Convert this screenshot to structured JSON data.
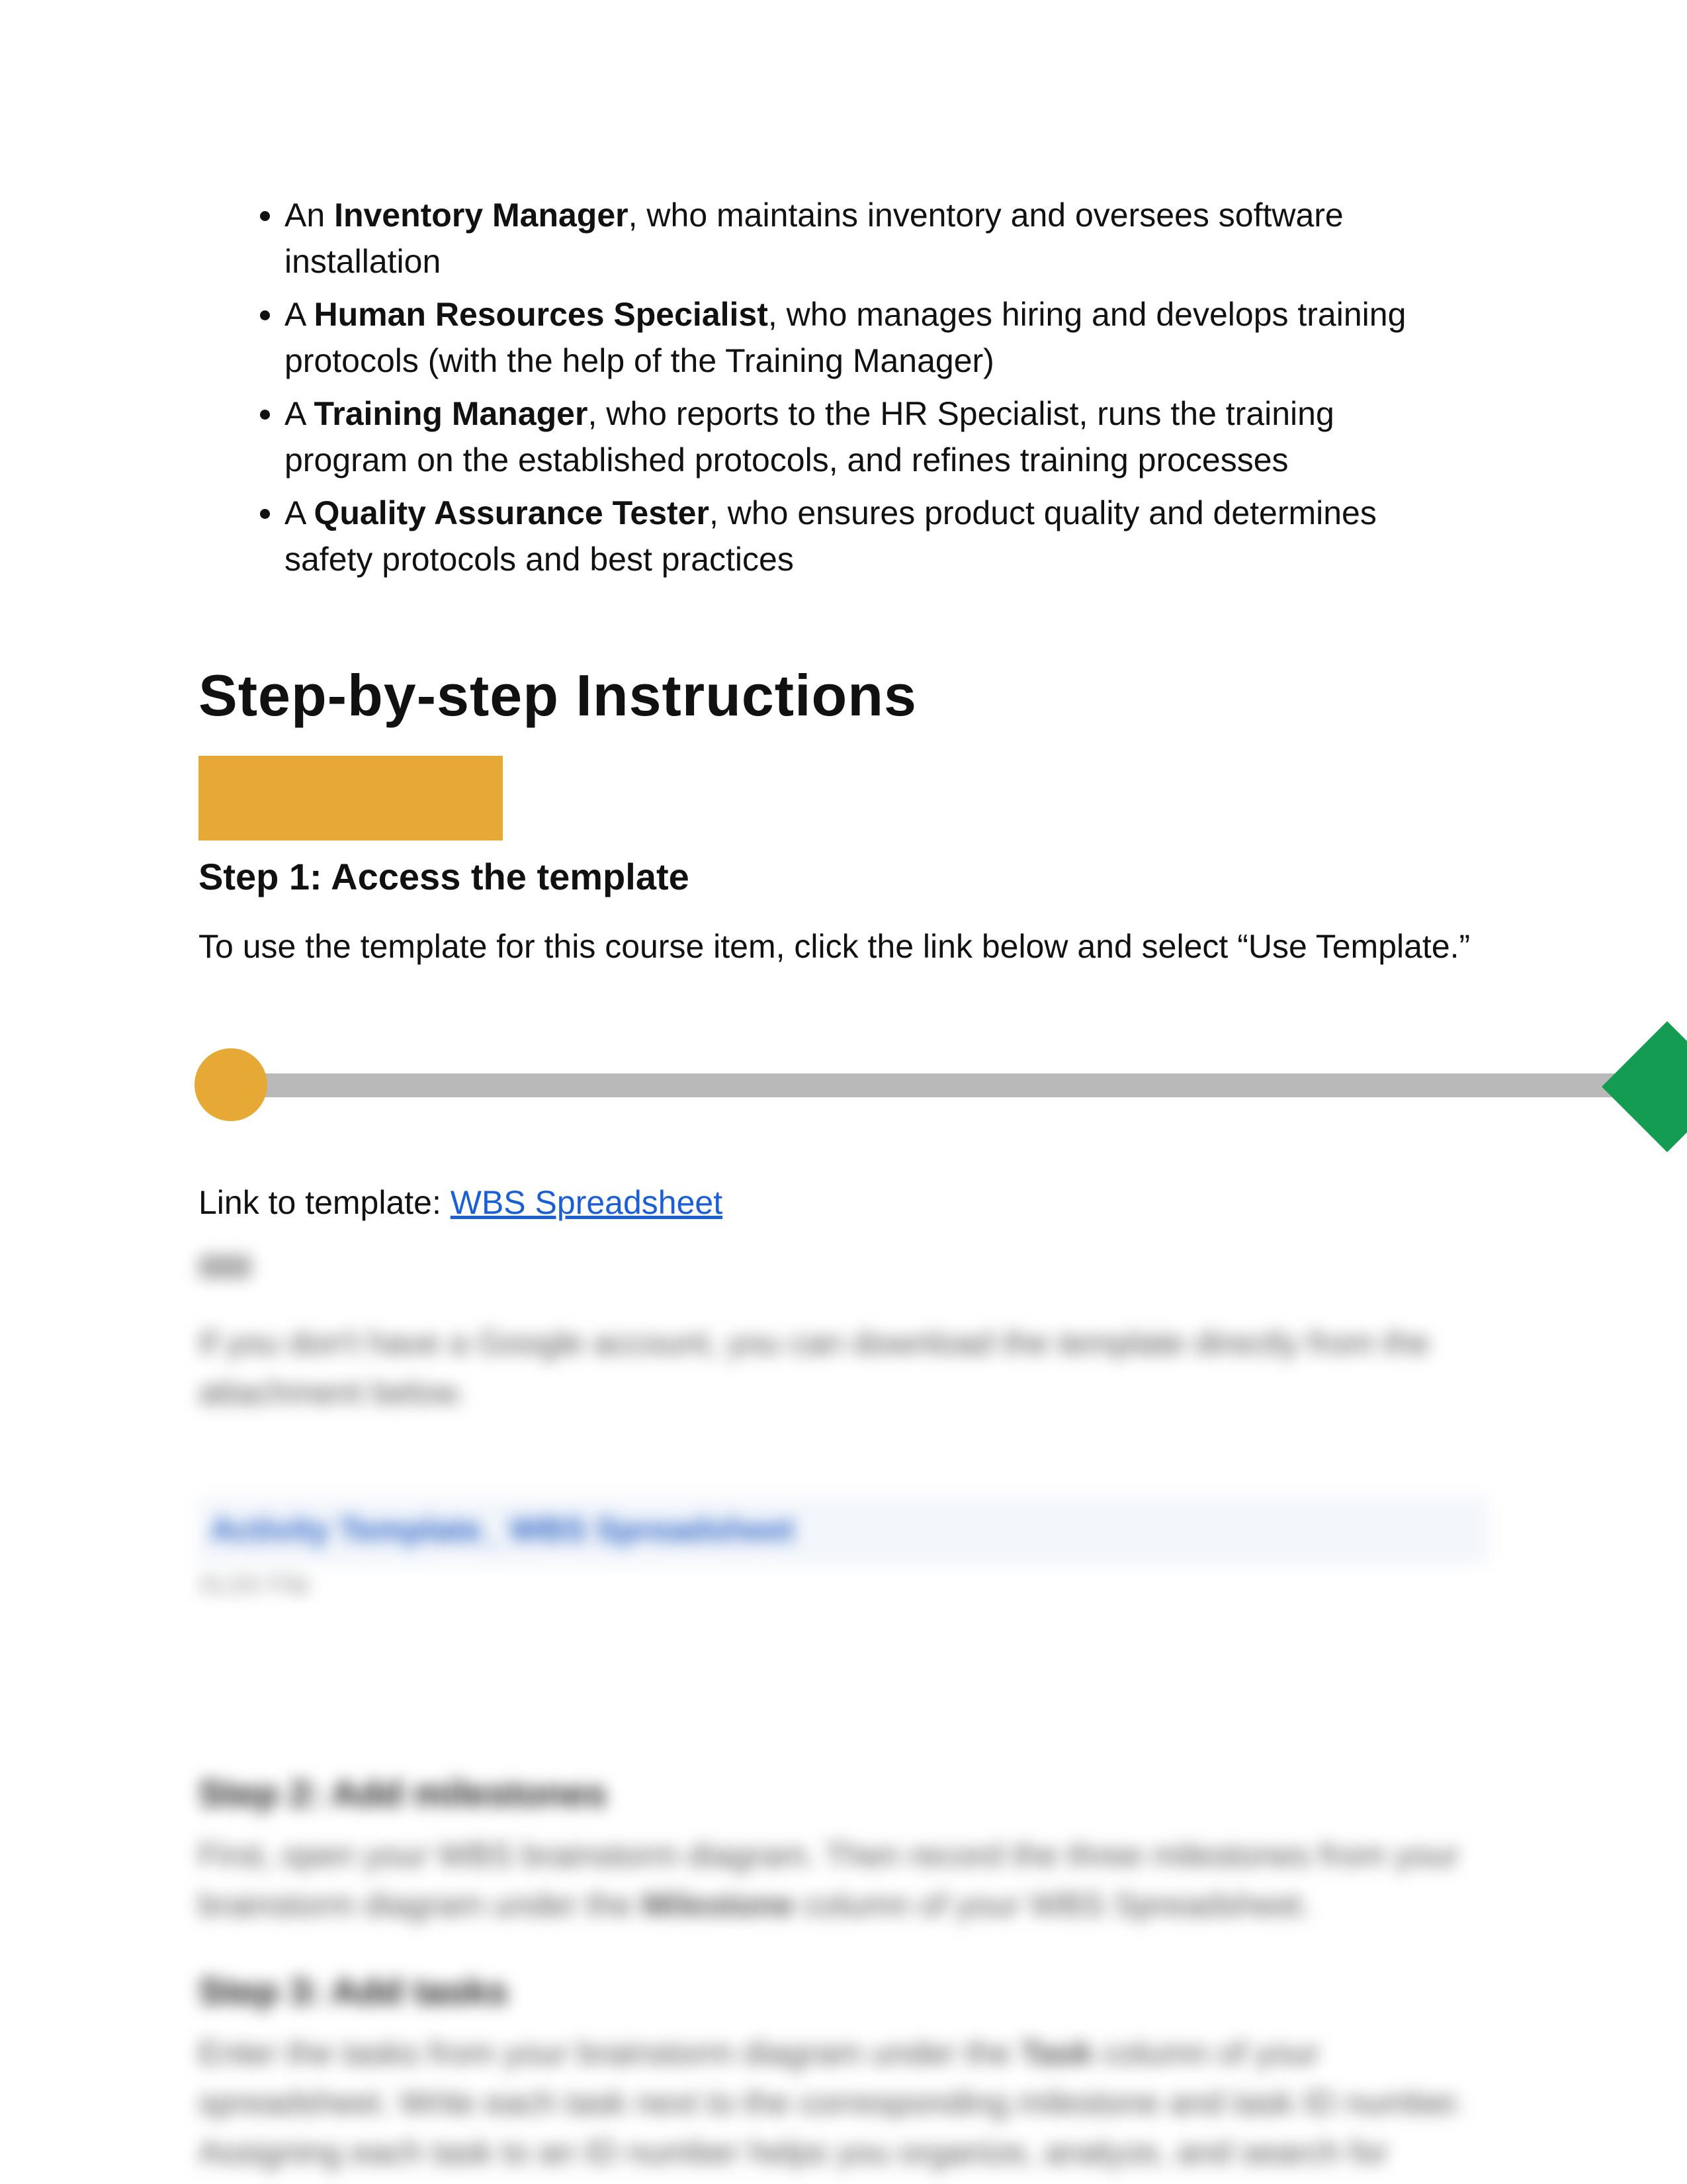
{
  "roles": [
    {
      "prefix": "An ",
      "title": "Inventory Manager",
      "rest": ", who maintains inventory and oversees software installation"
    },
    {
      "prefix": "A ",
      "title": "Human Resources Specialist",
      "rest": ", who manages hiring and develops training protocols (with the help of the Training Manager)"
    },
    {
      "prefix": "A ",
      "title": "Training Manager",
      "rest": ", who reports to the HR Specialist, runs the training program on the established protocols, and refines training processes"
    },
    {
      "prefix": "A ",
      "title": "Quality Assurance Tester",
      "rest": ", who ensures product quality and determines safety protocols and best practices"
    }
  ],
  "section_heading": "Step-by-step Instructions",
  "step1_heading": "Step 1: Access the template",
  "step1_body": "To use the template for this course item, click the link below and select “Use Template.”",
  "link_prefix": "Link to template: ",
  "link_text": "WBS Spreadsheet",
  "blurred": {
    "or_line": "OR",
    "para1": "If you don't have a Google account, you can download the template directly from the attachment below.",
    "download_link": "Activity Template_ WBS Spreadsheet",
    "download_sub": "XLSX File",
    "step2_h": "Step 2: Add milestones",
    "step2_body_a": "First, open your WBS brainstorm diagram. Then record the three milestones from your brainstorm diagram under the ",
    "step2_bold": "Milestone",
    "step2_body_b": " column of your WBS Spreadsheet.",
    "step3_h": "Step 3: Add tasks",
    "step3_body_a": "Enter the tasks from your brainstorm diagram under the ",
    "step3_bold": "Task",
    "step3_body_b": " column of your spreadsheet. Write each task next to the corresponding milestone and task ID number. Assigning each task to an ID number helps you organize, analyze, and search for"
  }
}
